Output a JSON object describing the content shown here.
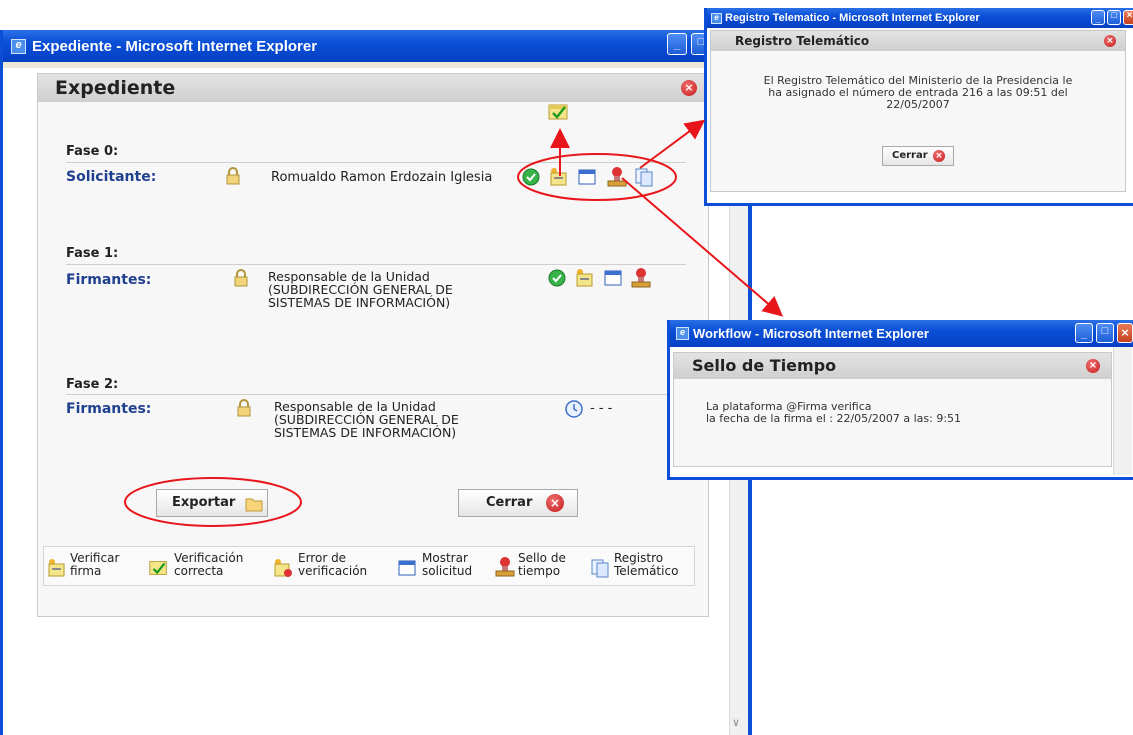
{
  "main_window": {
    "title": "Expediente - Microsoft Internet Explorer",
    "panel_title": "Expediente",
    "phases": [
      {
        "phase_label": "Fase 0:",
        "role_label": "Solicitante:",
        "person": "Romualdo Ramon Erdozain Iglesia"
      },
      {
        "phase_label": "Fase 1:",
        "role_label": "Firmantes:",
        "person_lines": [
          "Responsable de la Unidad",
          "(SUBDIRECCIÓN GENERAL DE",
          "SISTEMAS DE INFORMACIÓN)"
        ]
      },
      {
        "phase_label": "Fase 2:",
        "role_label": "Firmantes:",
        "person_lines": [
          "Responsable de la Unidad",
          "(SUBDIRECCIÓN GENERAL DE",
          "SISTEMAS DE INFORMACIÓN)"
        ],
        "status_text": "-   -   -"
      }
    ],
    "export_label": "Exportar",
    "close_label": "Cerrar",
    "legend": [
      {
        "line1": "Verificar",
        "line2": "firma",
        "icon": "verify-signature-icon"
      },
      {
        "line1": "Verificación",
        "line2": "correcta",
        "icon": "verification-ok-icon"
      },
      {
        "line1": "Error de",
        "line2": "verificación",
        "icon": "verification-error-icon"
      },
      {
        "line1": "Mostrar",
        "line2": "solicitud",
        "icon": "show-request-icon"
      },
      {
        "line1": "Sello de",
        "line2": "tiempo",
        "icon": "timestamp-stamp-icon"
      },
      {
        "line1": "Registro",
        "line2": "Telemático",
        "icon": "telematic-registry-icon"
      }
    ]
  },
  "registro_window": {
    "title": "Registro Telematico - Microsoft Internet Explorer",
    "panel_title": "Registro Telemático",
    "message_lines": [
      "El Registro Telemático del Ministerio de la Presidencia le",
      "ha asignado el número de entrada 216 a las 09:51 del",
      "22/05/2007"
    ],
    "close_label": "Cerrar"
  },
  "workflow_window": {
    "title": "Workflow - Microsoft Internet Explorer",
    "panel_title": "Sello de Tiempo",
    "message_lines": [
      "La plataforma @Firma verifica",
      "la fecha de la firma el : 22/05/2007 a las: 9:51"
    ]
  },
  "colors": {
    "titlebar_blue": "#0a4fd6",
    "label_blue": "#1f3f8f",
    "annotation_red": "#e8161b",
    "close_red": "#c41a1a"
  }
}
